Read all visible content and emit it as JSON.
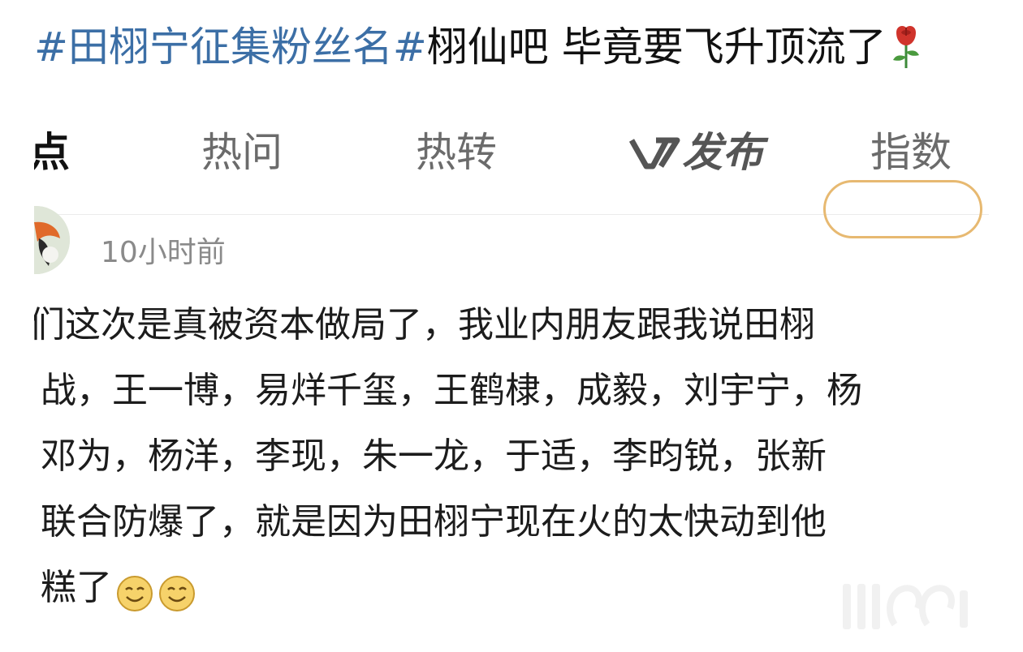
{
  "post": {
    "hashtag": "#田栩宁征集粉丝名#",
    "text": "栩仙吧 毕竟要飞升顶流了",
    "emoji": "rose-icon"
  },
  "screenshot": {
    "tabs": [
      {
        "label": "点",
        "active": true
      },
      {
        "label": "热问",
        "active": false
      },
      {
        "label": "热转",
        "active": false
      },
      {
        "label": "发布",
        "prefix_icon": "v-logo-icon",
        "active": false
      },
      {
        "label": "指数",
        "active": false
      }
    ],
    "timestamp": "10小时前",
    "comment_lines": [
      "们这次是真被资本做局了，我业内朋友跟我说田栩",
      "战，王一博，易烊千玺，王鹤棣，成毅，刘宇宁，杨",
      "邓为，杨洋，李现，朱一龙，于适，李昀锐，张新",
      "联合防爆了，就是因为田栩宁现在火的太快动到他",
      "糕了"
    ],
    "comment_emojis": [
      "smile-icon",
      "smile-icon"
    ],
    "colors": {
      "hashtag": "#3c6fa6",
      "follow_border": "#e7b971",
      "muted_text": "#8a8a8a"
    }
  }
}
